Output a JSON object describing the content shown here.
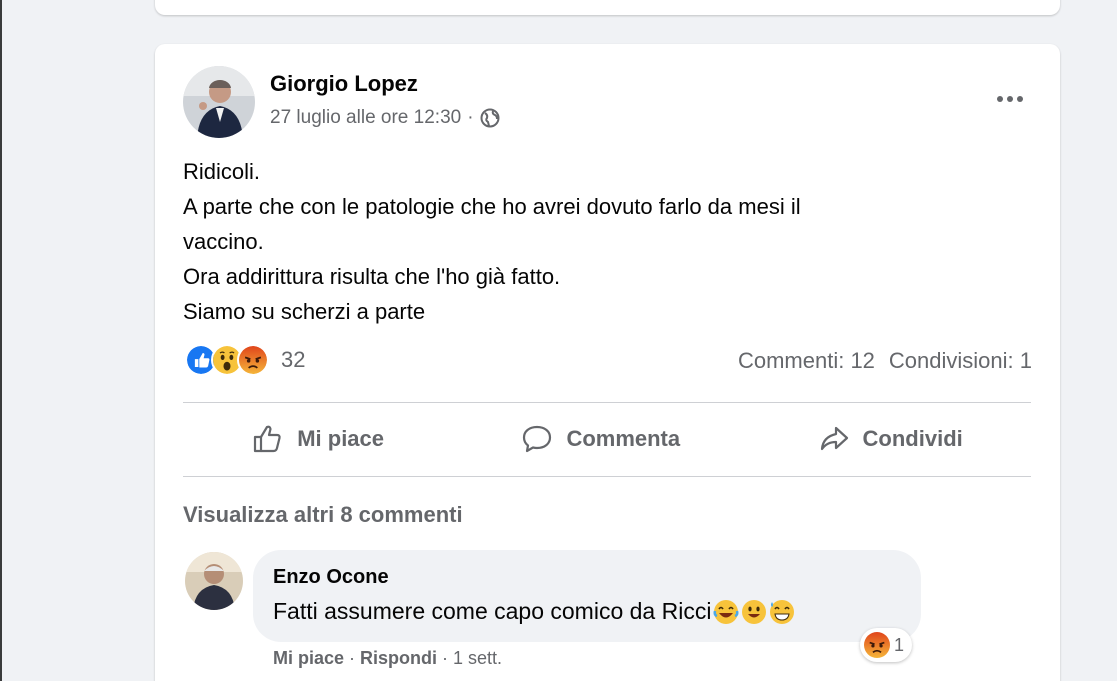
{
  "post": {
    "author": "Giorgio Lopez",
    "date": "27 luglio alle ore 12:30",
    "meta_separator": "·",
    "lines": [
      "Ridicoli.",
      "A parte che con le patologie che ho avrei dovuto farlo da mesi il",
      "vaccino.",
      "Ora addirittura risulta che l'ho già fatto.",
      "Siamo su scherzi a parte"
    ],
    "reaction_icons": [
      "like-reaction-icon",
      "wow-reaction-icon",
      "angry-reaction-icon"
    ],
    "reaction_count": "32",
    "comments_count": "Commenti: 12",
    "shares_count": "Condivisioni: 1"
  },
  "actions": {
    "like": "Mi piace",
    "comment": "Commenta",
    "share": "Condividi"
  },
  "comments": {
    "more_label": "Visualizza altri 8 commenti",
    "items": [
      {
        "author": "Enzo Ocone",
        "text": "Fatti assumere come capo comico da Ricci",
        "emojis": [
          "laughing-tears-emoji",
          "smiley-emoji",
          "grin-sweat-emoji"
        ],
        "reaction_icon": "angry-reaction-icon",
        "reaction_count": "1",
        "like_label": "Mi piace",
        "sep1": "·",
        "reply_label": "Rispondi",
        "sep2": "·",
        "time": "1 sett."
      }
    ]
  },
  "colors": {
    "page_bg": "#f0f2f5",
    "card_bg": "#ffffff",
    "secondary_text": "#65676b",
    "like_blue": "#1877f2",
    "angry_orange": "#e9710f"
  }
}
